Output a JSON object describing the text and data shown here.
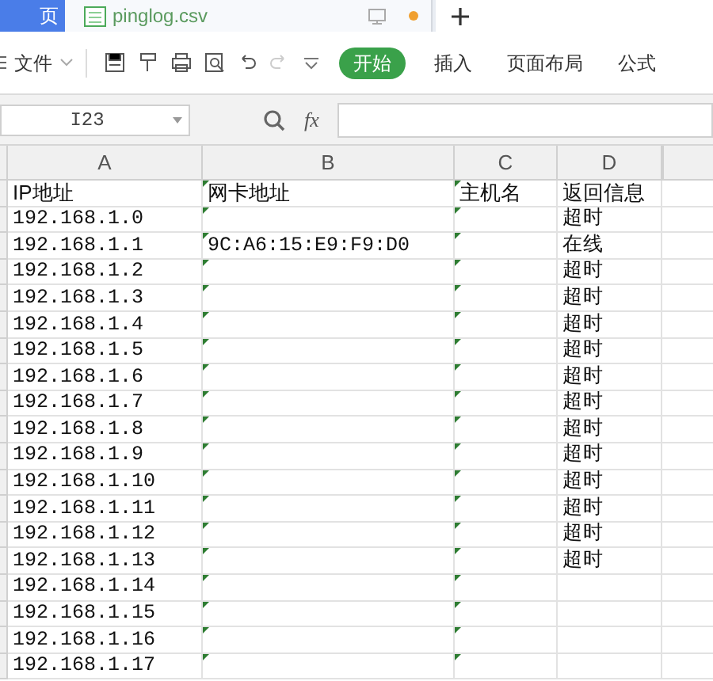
{
  "tabs": [
    {
      "label": "页",
      "selected": false,
      "kind": "home"
    },
    {
      "label": "pinglog.csv",
      "selected": true,
      "kind": "file"
    }
  ],
  "toolbar": {
    "file_menu": "文件",
    "ribbon_tabs": [
      {
        "label": "开始",
        "selected": true
      },
      {
        "label": "插入",
        "selected": false
      },
      {
        "label": "页面布局",
        "selected": false
      },
      {
        "label": "公式",
        "selected": false
      }
    ]
  },
  "name_box": "I23",
  "formula_label": "fx",
  "columns": [
    "A",
    "B",
    "C",
    "D"
  ],
  "rows": [
    {
      "cells": [
        "IP地址",
        "网卡地址",
        "主机名",
        "返回信息"
      ]
    },
    {
      "cells": [
        "192.168.1.0",
        "",
        "",
        "超时"
      ]
    },
    {
      "cells": [
        "192.168.1.1",
        "9C:A6:15:E9:F9:D0",
        "",
        "在线"
      ]
    },
    {
      "cells": [
        "192.168.1.2",
        "",
        "",
        "超时"
      ]
    },
    {
      "cells": [
        "192.168.1.3",
        "",
        "",
        "超时"
      ]
    },
    {
      "cells": [
        "192.168.1.4",
        "",
        "",
        "超时"
      ]
    },
    {
      "cells": [
        "192.168.1.5",
        "",
        "",
        "超时"
      ]
    },
    {
      "cells": [
        "192.168.1.6",
        "",
        "",
        "超时"
      ]
    },
    {
      "cells": [
        "192.168.1.7",
        "",
        "",
        "超时"
      ]
    },
    {
      "cells": [
        "192.168.1.8",
        "",
        "",
        "超时"
      ]
    },
    {
      "cells": [
        "192.168.1.9",
        "",
        "",
        "超时"
      ]
    },
    {
      "cells": [
        "192.168.1.10",
        "",
        "",
        "超时"
      ]
    },
    {
      "cells": [
        "192.168.1.11",
        "",
        "",
        "超时"
      ]
    },
    {
      "cells": [
        "192.168.1.12",
        "",
        "",
        "超时"
      ]
    },
    {
      "cells": [
        "192.168.1.13",
        "",
        "",
        "超时"
      ]
    },
    {
      "cells": [
        "192.168.1.14",
        "",
        "",
        ""
      ]
    },
    {
      "cells": [
        "192.168.1.15",
        "",
        "",
        ""
      ]
    },
    {
      "cells": [
        "192.168.1.16",
        "",
        "",
        ""
      ]
    },
    {
      "cells": [
        "192.168.1.17",
        "",
        "",
        ""
      ]
    }
  ]
}
